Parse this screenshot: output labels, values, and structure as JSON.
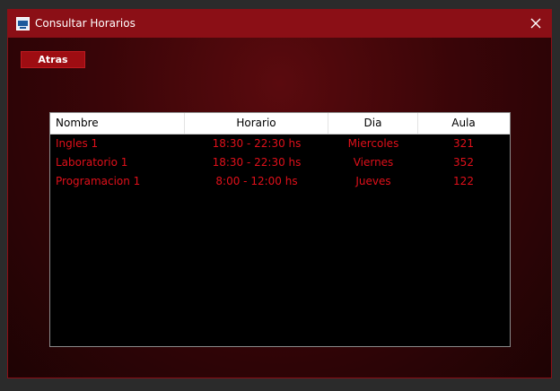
{
  "window": {
    "title": "Consultar Horarios",
    "icon": "app-icon",
    "close_icon": "close-icon"
  },
  "toolbar": {
    "back_label": "Atras"
  },
  "table": {
    "columns": [
      "Nombre",
      "Horario",
      "Dia",
      "Aula"
    ],
    "rows": [
      [
        "Ingles 1",
        "18:30 - 22:30 hs",
        "Miercoles",
        "321"
      ],
      [
        "Laboratorio 1",
        "18:30 - 22:30 hs",
        "Viernes",
        "352"
      ],
      [
        "Programacion 1",
        "8:00 - 12:00 hs",
        "Jueves",
        "122"
      ]
    ]
  },
  "colors": {
    "accent": "#8b0f16",
    "button": "#9e0d12",
    "row_text": "#e0101a",
    "grid_bg": "#000000"
  }
}
